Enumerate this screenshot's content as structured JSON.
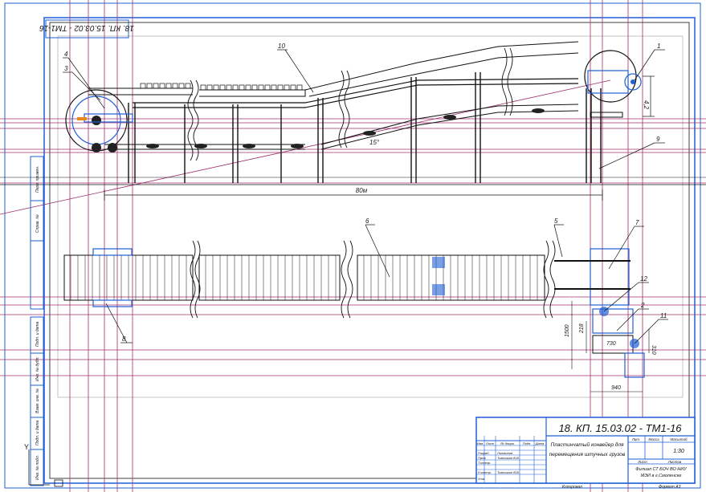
{
  "drawing": {
    "doc_code_title": "18. КП. 15.03.02 - ТМ1-16",
    "doc_code_rotated": "18. КП. 15.03.02 - ТМ1-16",
    "product_name_line1": "Пластинчатый конвейер для",
    "product_name_line2": "перемещения штучных грузов",
    "sheet_label": "Лит.",
    "mass_label": "Масса",
    "scale_label": "Масштаб",
    "scale_value": "1:30",
    "sheet_word": "Лист",
    "sheets_word": "Листов",
    "org_line1": "Филиал СТ БОЧ ВО НИУ",
    "org_line2": "МЭИ в г.Смоленске",
    "copy_label": "Копировал",
    "format_label": "Формат А3",
    "roles": [
      {
        "role": "Изм.",
        "name": "Лист"
      },
      {
        "role": "Разраб.",
        "name": "Литвинов"
      },
      {
        "role": "Пров.",
        "name": "Тимошкин В.В."
      },
      {
        "role": "Т.контр.",
        "name": ""
      },
      {
        "role": "Н.контр.",
        "name": "Тимошкин В.В."
      },
      {
        "role": "Утв.",
        "name": ""
      }
    ],
    "columns": [
      "Изм.",
      "Лист",
      "№ докум.",
      "Подп.",
      "Дата"
    ]
  },
  "callouts": [
    "1",
    "2",
    "3",
    "4",
    "5",
    "6",
    "7",
    "8",
    "9",
    "10",
    "11",
    "12"
  ],
  "dimensions": {
    "length": "80м",
    "angle": "15°",
    "height": "4,2",
    "width1": "1500",
    "width2": "730",
    "width3": "940",
    "dim4": "310",
    "dim5": "218"
  },
  "side_stamps": [
    "Инв. № подл.",
    "Подп. и дата",
    "Взам. инв. №",
    "Инв. № дубл.",
    "Подп. и дата",
    "Справ. №",
    "Перв. примен."
  ],
  "axis": {
    "label": "Y"
  }
}
